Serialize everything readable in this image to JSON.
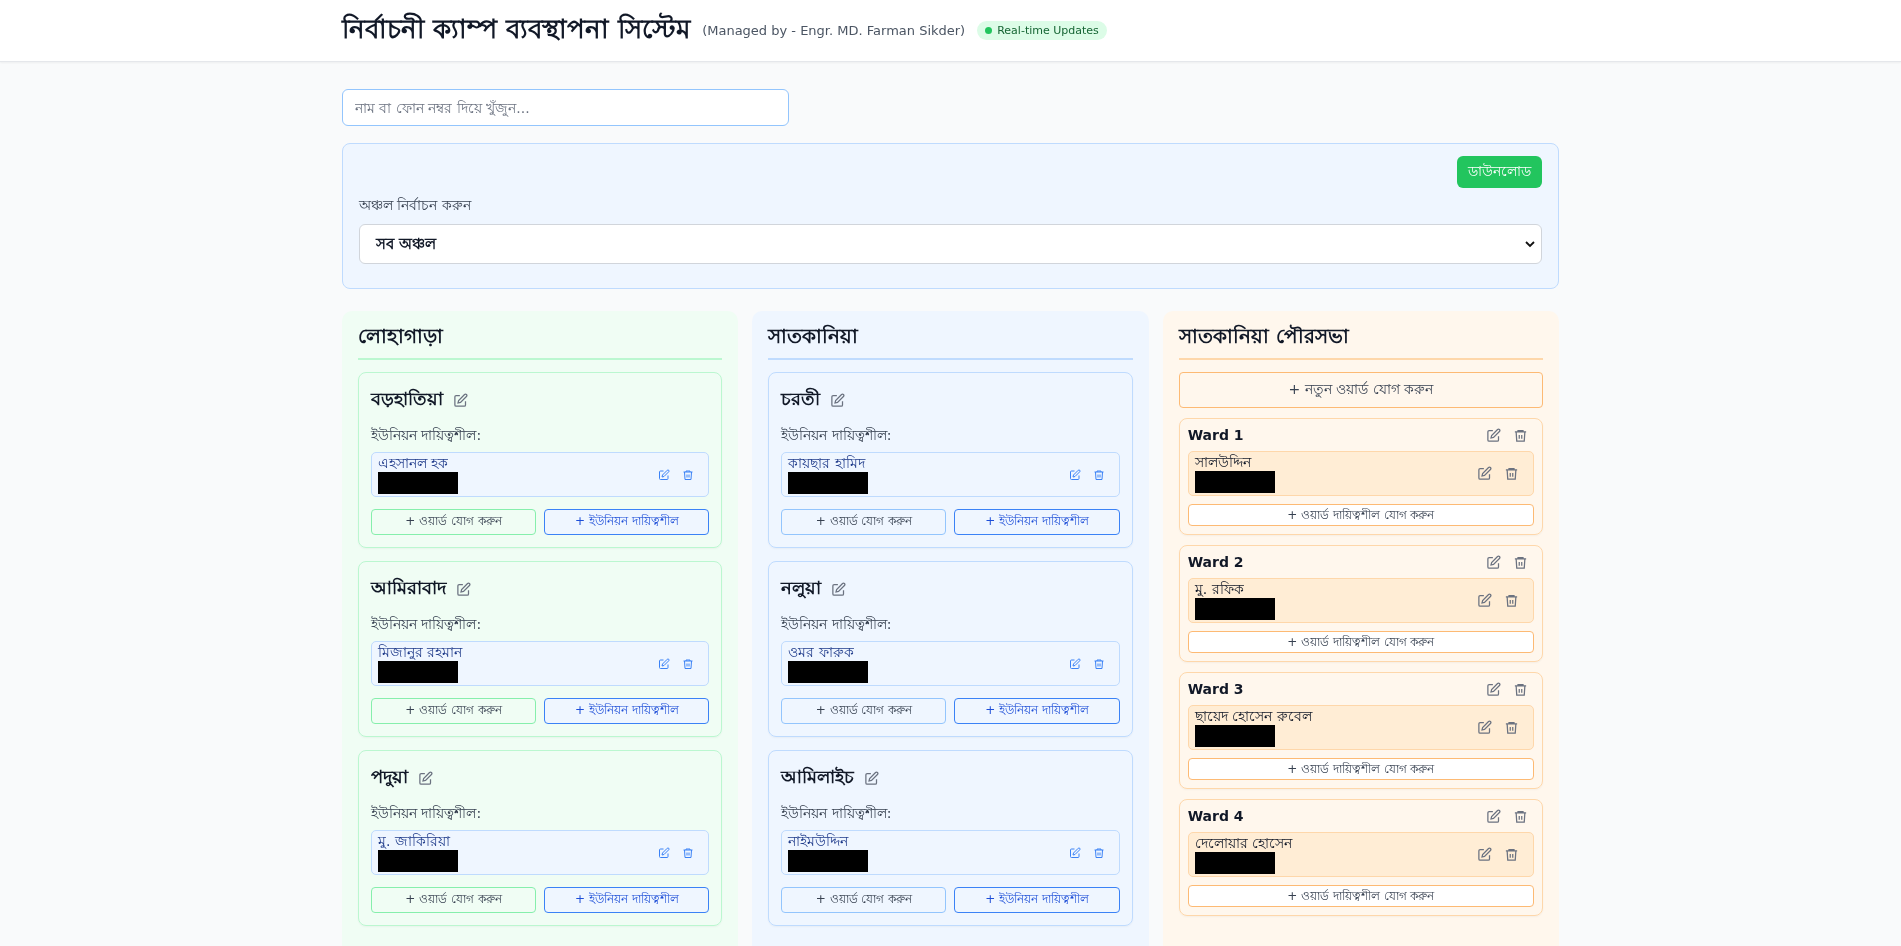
{
  "header": {
    "title": "নির্বাচনী ক্যাম্প ব্যবস্থাপনা সিস্টেম",
    "subtitle": "(Managed by - Engr. MD. Farman Sikder)",
    "badge": "Real-time Updates"
  },
  "search": {
    "placeholder": "নাম বা ফোন নম্বর দিয়ে খুঁজুন..."
  },
  "filter": {
    "download_button": "ডাউনলোড",
    "label": "অঞ্চল নির্বাচন করুন",
    "select_value": "সব অঞ্চল"
  },
  "columns": [
    {
      "name": "লোহাগাড়া",
      "color": "#f0fdf4",
      "kind": "unions",
      "unions": [
        {
          "name": "বড়হাতিয়া",
          "responsible_label": "ইউনিয়ন দায়িত্বশীল:",
          "responsible": [
            {
              "name": "এহসানল হক",
              "phone_redacted": true
            }
          ],
          "add_ward_button": "+ ওয়ার্ড যোগ করুন",
          "add_responsible_button": "+ ইউনিয়ন দায়িত্বশীল"
        },
        {
          "name": "আমিরাবাদ",
          "responsible_label": "ইউনিয়ন দায়িত্বশীল:",
          "responsible": [
            {
              "name": "মিজানুর রহমান",
              "phone_redacted": true
            }
          ],
          "add_ward_button": "+ ওয়ার্ড যোগ করুন",
          "add_responsible_button": "+ ইউনিয়ন দায়িত্বশীল"
        },
        {
          "name": "পদুয়া",
          "responsible_label": "ইউনিয়ন দায়িত্বশীল:",
          "responsible": [
            {
              "name": "মু. জাকিরিয়া",
              "phone_redacted": true
            }
          ],
          "add_ward_button": "+ ওয়ার্ড যোগ করুন",
          "add_responsible_button": "+ ইউনিয়ন দায়িত্বশীল"
        }
      ]
    },
    {
      "name": "সাতকানিয়া",
      "color": "#eff6ff",
      "kind": "unions",
      "unions": [
        {
          "name": "চরতী",
          "responsible_label": "ইউনিয়ন দায়িত্বশীল:",
          "responsible": [
            {
              "name": "কায়ছার হামিদ",
              "phone_redacted": true
            }
          ],
          "add_ward_button": "+ ওয়ার্ড যোগ করুন",
          "add_responsible_button": "+ ইউনিয়ন দায়িত্বশীল"
        },
        {
          "name": "নলুয়া",
          "responsible_label": "ইউনিয়ন দায়িত্বশীল:",
          "responsible": [
            {
              "name": "ওমর ফারুক",
              "phone_redacted": true
            }
          ],
          "add_ward_button": "+ ওয়ার্ড যোগ করুন",
          "add_responsible_button": "+ ইউনিয়ন দায়িত্বশীল"
        },
        {
          "name": "আমিলাইচ",
          "responsible_label": "ইউনিয়ন দায়িত্বশীল:",
          "responsible": [
            {
              "name": "নাইমউদ্দিন",
              "phone_redacted": true
            }
          ],
          "add_ward_button": "+ ওয়ার্ড যোগ করুন",
          "add_responsible_button": "+ ইউনিয়ন দায়িত্বশীল"
        }
      ]
    },
    {
      "name": "সাতকানিয়া পৌরসভা",
      "color": "#fff7ed",
      "kind": "wards",
      "add_ward_button": "+ নতুন ওয়ার্ড যোগ করুন",
      "wards": [
        {
          "name": "Ward 1",
          "responsible": [
            {
              "name": "সালউদ্দিন",
              "phone_redacted": true
            }
          ],
          "add_responsible_button": "+ ওয়ার্ড দায়িত্বশীল যোগ করুন"
        },
        {
          "name": "Ward 2",
          "responsible": [
            {
              "name": "মু. রফিক",
              "phone_redacted": true
            }
          ],
          "add_responsible_button": "+ ওয়ার্ড দায়িত্বশীল যোগ করুন"
        },
        {
          "name": "Ward 3",
          "responsible": [
            {
              "name": "ছায়েদ হোসেন রুবেল",
              "phone_redacted": true
            }
          ],
          "add_responsible_button": "+ ওয়ার্ড দায়িত্বশীল যোগ করুন"
        },
        {
          "name": "Ward 4",
          "responsible": [
            {
              "name": "দেলোয়ার হোসেন",
              "phone_redacted": true
            }
          ],
          "add_responsible_button": "+ ওয়ার্ড দায়িত্বশীল যোগ করুন"
        }
      ]
    }
  ]
}
